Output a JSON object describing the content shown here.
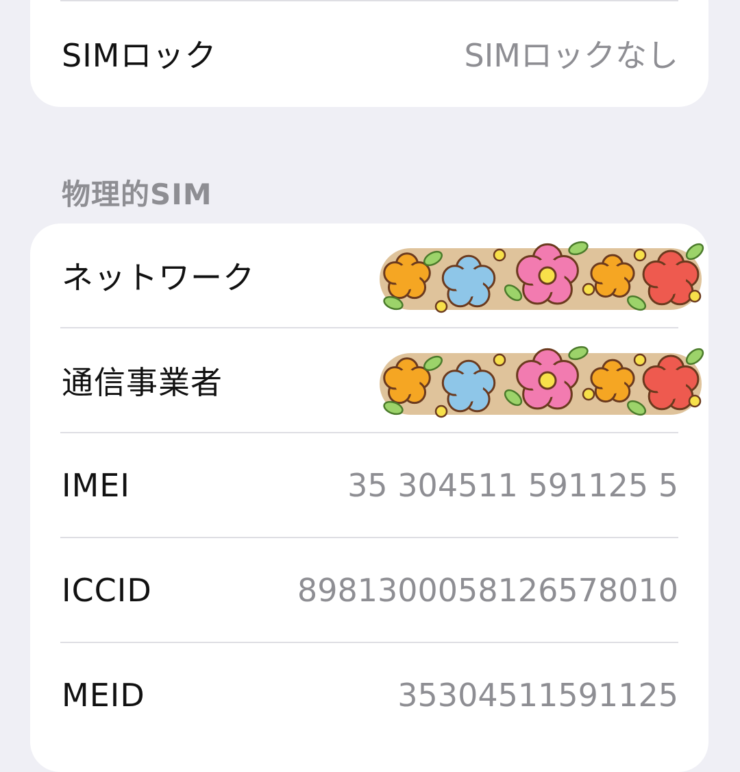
{
  "sim_lock": {
    "label": "SIMロック",
    "value": "SIMロックなし"
  },
  "physical_sim": {
    "header": "物理的SIM",
    "rows": [
      {
        "label": "ネットワーク",
        "value_redacted": true
      },
      {
        "label": "通信事業者",
        "value_redacted": true
      },
      {
        "label": "IMEI",
        "value": "35 304511 591125 5"
      },
      {
        "label": "ICCID",
        "value": "8981300058126578010"
      },
      {
        "label": "MEID",
        "value": "35304511591125"
      }
    ]
  },
  "colors": {
    "background": "#efeff5",
    "card": "#ffffff",
    "label": "#111111",
    "value": "#8e8e93",
    "separator": "#dedee3",
    "sticker_orange": "#f5a623",
    "sticker_blue": "#8ec6e8",
    "sticker_pink": "#f27bb0",
    "sticker_red": "#ee5a4f",
    "sticker_yellow": "#f7e04a",
    "sticker_leaf": "#9cd36a"
  },
  "icons": {
    "redaction_sticker": "flower-sticker-icon"
  }
}
